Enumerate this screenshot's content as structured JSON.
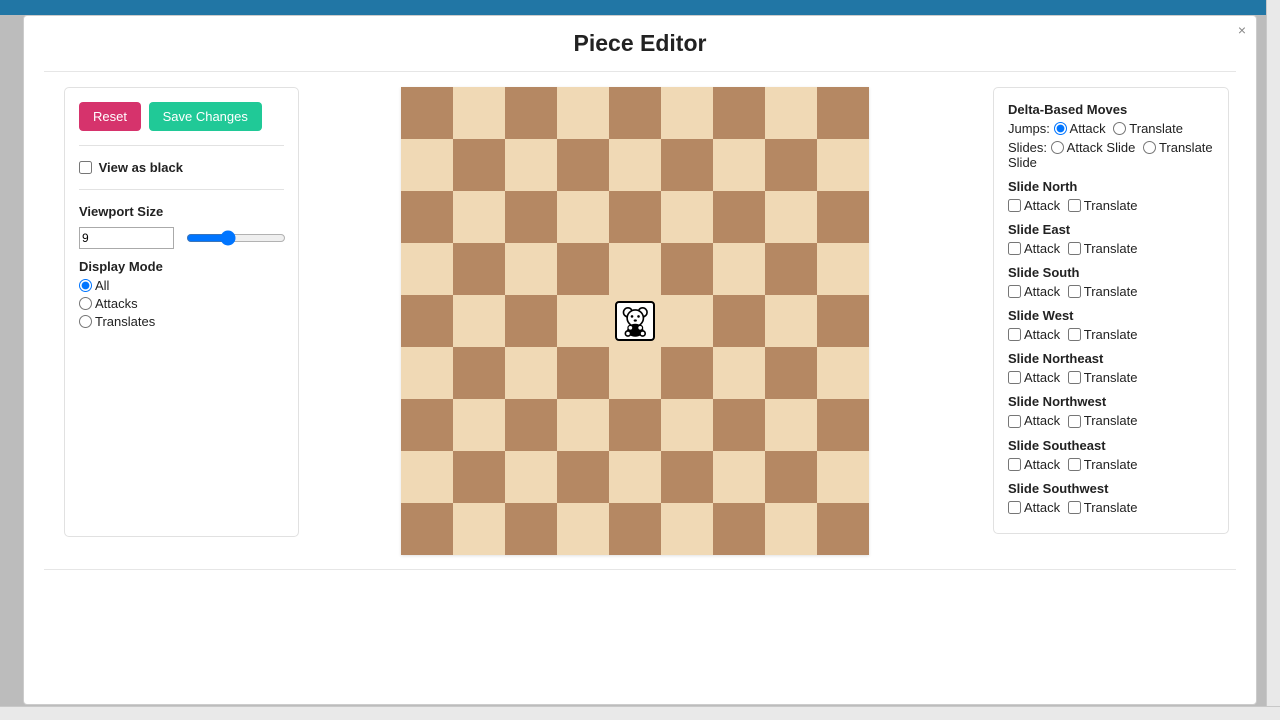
{
  "modal_title": "Piece Editor",
  "left": {
    "reset_label": "Reset",
    "save_label": "Save Changes",
    "view_black_label": "View as black",
    "view_black_checked": false,
    "viewport_label": "Viewport Size",
    "viewport_value": "9",
    "display_mode_label": "Display Mode",
    "display_modes": [
      {
        "label": "All",
        "checked": true
      },
      {
        "label": "Attacks",
        "checked": false
      },
      {
        "label": "Translates",
        "checked": false
      }
    ]
  },
  "board": {
    "size": 9,
    "piece_row": 4,
    "piece_col": 4,
    "piece_name": "bear-piece"
  },
  "right": {
    "delta_title": "Delta-Based Moves",
    "jumps_label": "Jumps:",
    "slides_label": "Slides:",
    "jump_options": [
      {
        "label": "Attack",
        "checked": true
      },
      {
        "label": "Translate",
        "checked": false
      }
    ],
    "slide_options": [
      {
        "label": "Attack Slide",
        "checked": false
      },
      {
        "label": "Translate Slide",
        "checked": false
      }
    ],
    "directions": [
      "Slide North",
      "Slide East",
      "Slide South",
      "Slide West",
      "Slide Northeast",
      "Slide Northwest",
      "Slide Southeast",
      "Slide Southwest"
    ],
    "dir_attack_label": "Attack",
    "dir_translate_label": "Translate"
  }
}
